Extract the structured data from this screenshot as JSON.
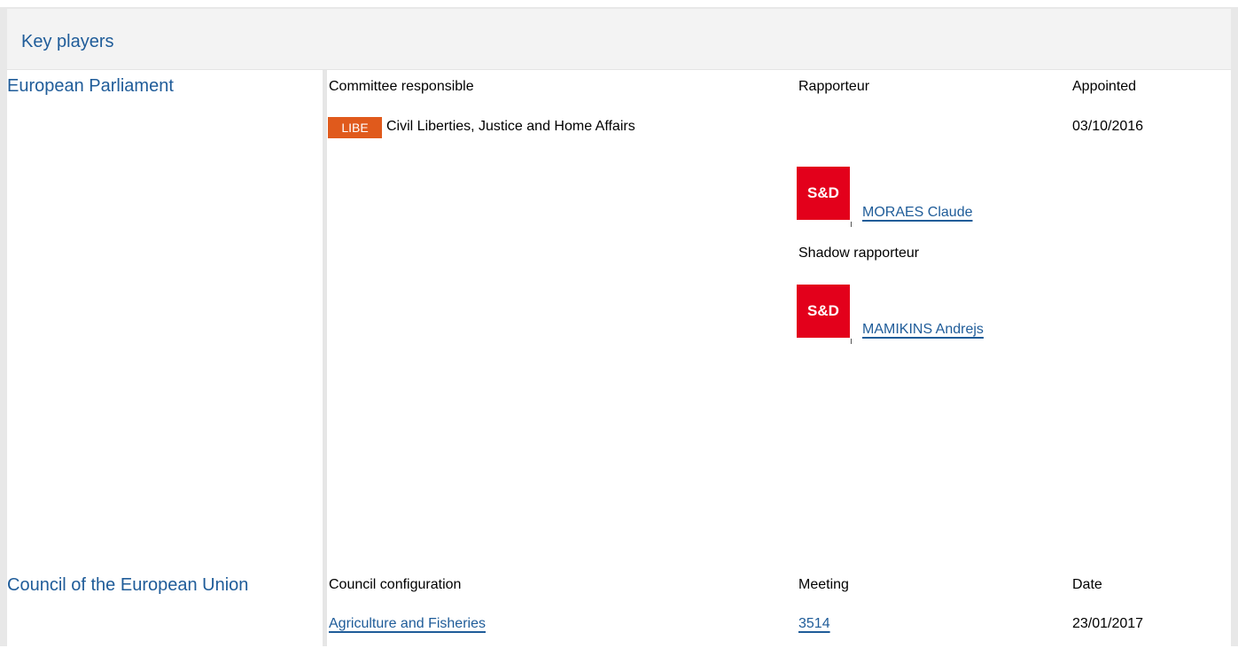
{
  "header": {
    "title": "Key players"
  },
  "european_parliament": {
    "label": "European Parliament",
    "columns": {
      "committee": "Committee responsible",
      "rapporteur": "Rapporteur",
      "appointed": "Appointed"
    },
    "committee": {
      "code": "LIBE",
      "name": "Civil Liberties, Justice and Home Affairs",
      "appointed": "03/10/2016"
    },
    "rapporteur": {
      "party_logo": "S&D",
      "name": "MORAES Claude"
    },
    "shadow_label": "Shadow rapporteur",
    "shadow_rapporteur": {
      "party_logo": "S&D",
      "name": "MAMIKINS Andrejs"
    }
  },
  "council": {
    "label": "Council of the European Union",
    "columns": {
      "configuration": "Council configuration",
      "meeting": "Meeting",
      "date": "Date"
    },
    "row": {
      "configuration": "Agriculture and Fisheries",
      "meeting": "3514",
      "date": "23/01/2017"
    }
  },
  "colors": {
    "link": "#1f5c99",
    "committee_badge": "#e05a1c",
    "sd_red": "#e3001b",
    "header_bg": "#f3f3f3"
  }
}
